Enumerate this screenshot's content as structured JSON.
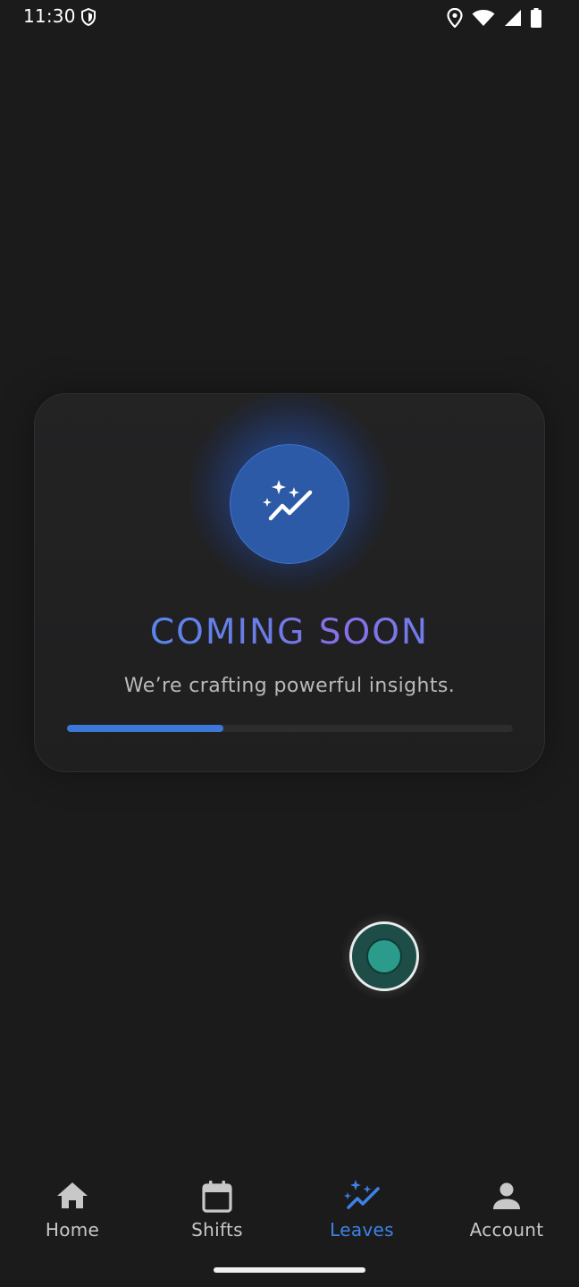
{
  "status_bar": {
    "time": "11:30",
    "icons": [
      "shield-icon",
      "location-icon",
      "wifi-icon",
      "signal-icon",
      "battery-icon"
    ]
  },
  "card": {
    "icon": "sparkle-chart-icon",
    "title": "COMING SOON",
    "subtitle": "We’re crafting powerful insights.",
    "progress": 0.35,
    "accent_color": "#3b78d8"
  },
  "fab": {
    "icon": "floating-bubble-icon",
    "color": "#2b9c8c"
  },
  "bottom_nav": {
    "items": [
      {
        "label": "Home",
        "icon": "home-icon",
        "active": false
      },
      {
        "label": "Shifts",
        "icon": "calendar-icon",
        "active": false
      },
      {
        "label": "Leaves",
        "icon": "sparkle-chart-icon",
        "active": true
      },
      {
        "label": "Account",
        "icon": "person-icon",
        "active": false
      }
    ],
    "active_color": "#3d82e6",
    "inactive_color": "#c8c8c8"
  }
}
